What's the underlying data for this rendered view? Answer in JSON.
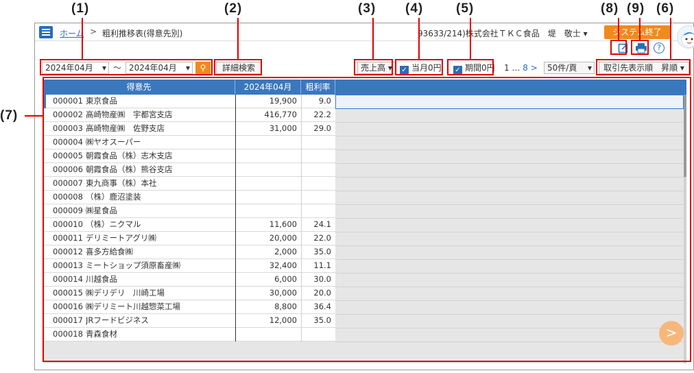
{
  "annotations": {
    "a1": "(1)",
    "a2": "(2)",
    "a3": "(3)",
    "a4": "(4)",
    "a5": "(5)",
    "a8": "(8)",
    "a9": "(9)",
    "a6": "(6)",
    "a7": "(7)"
  },
  "header": {
    "home_link": "ホーム",
    "separator": ">",
    "page_title": "粗利推移表(得意先別)",
    "user_info": "93633/214)株式会社ＴＫＣ食品　堤　敬士 ▾",
    "system_end": "システム終了"
  },
  "icons": {
    "export": "↗",
    "print": "▬",
    "help": "?"
  },
  "toolbar": {
    "date_from": "2024年04月",
    "tilde": "〜",
    "date_to": "2024年04月",
    "dropdown_arrow": "▾",
    "search_icon": "⚲",
    "detail_search": "詳細検索",
    "measure": "売上高 ▾",
    "current_zero": "当月0円",
    "period_zero": "期間0円",
    "check_mark": "✓",
    "page_first": "1",
    "page_ellipsis": "…",
    "page_last": "8",
    "page_next": ">",
    "per_page": "50件/頁",
    "sort_order": "取引先表示順　昇順 ▾"
  },
  "table": {
    "columns": [
      "得意先",
      "2024年04月",
      "粗利率"
    ],
    "rows": [
      {
        "code": "000001",
        "name": "東京食品",
        "amount": "19,900",
        "rate": "9.0"
      },
      {
        "code": "000002",
        "name": "高崎物産㈱　宇都宮支店",
        "amount": "416,770",
        "rate": "22.2"
      },
      {
        "code": "000003",
        "name": "高崎物産㈱　佐野支店",
        "amount": "31,000",
        "rate": "29.0"
      },
      {
        "code": "000004",
        "name": "㈱ヤオスーパー",
        "amount": "",
        "rate": ""
      },
      {
        "code": "000005",
        "name": "朝霞食品（株）志木支店",
        "amount": "",
        "rate": ""
      },
      {
        "code": "000006",
        "name": "朝霞食品（株）熊谷支店",
        "amount": "",
        "rate": ""
      },
      {
        "code": "000007",
        "name": "東九商事（株）本社",
        "amount": "",
        "rate": ""
      },
      {
        "code": "000008",
        "name": "（株）鹿沼塗装",
        "amount": "",
        "rate": ""
      },
      {
        "code": "000009",
        "name": "㈱星食品",
        "amount": "",
        "rate": ""
      },
      {
        "code": "000010",
        "name": "（株）ニクマル",
        "amount": "11,600",
        "rate": "24.1"
      },
      {
        "code": "000011",
        "name": "デリミートアグリ㈱",
        "amount": "20,000",
        "rate": "22.0"
      },
      {
        "code": "000012",
        "name": "喜多方給食㈱",
        "amount": "2,000",
        "rate": "35.0"
      },
      {
        "code": "000013",
        "name": "ミートショップ須原畜産㈱",
        "amount": "32,400",
        "rate": "11.1"
      },
      {
        "code": "000014",
        "name": "川越食品",
        "amount": "6,000",
        "rate": "30.0"
      },
      {
        "code": "000015",
        "name": "㈱デリデリ　川崎工場",
        "amount": "30,000",
        "rate": "20.0"
      },
      {
        "code": "000016",
        "name": "㈱デリミート川越惣菜工場",
        "amount": "8,800",
        "rate": "36.4"
      },
      {
        "code": "000017",
        "name": "JRフードビジネス",
        "amount": "12,000",
        "rate": "35.0"
      },
      {
        "code": "000018",
        "name": "青森食材",
        "amount": "",
        "rate": ""
      }
    ]
  },
  "colors": {
    "accent": "#2b6cb8",
    "orange": "#f08a1c",
    "annotation_red": "#e00000"
  }
}
